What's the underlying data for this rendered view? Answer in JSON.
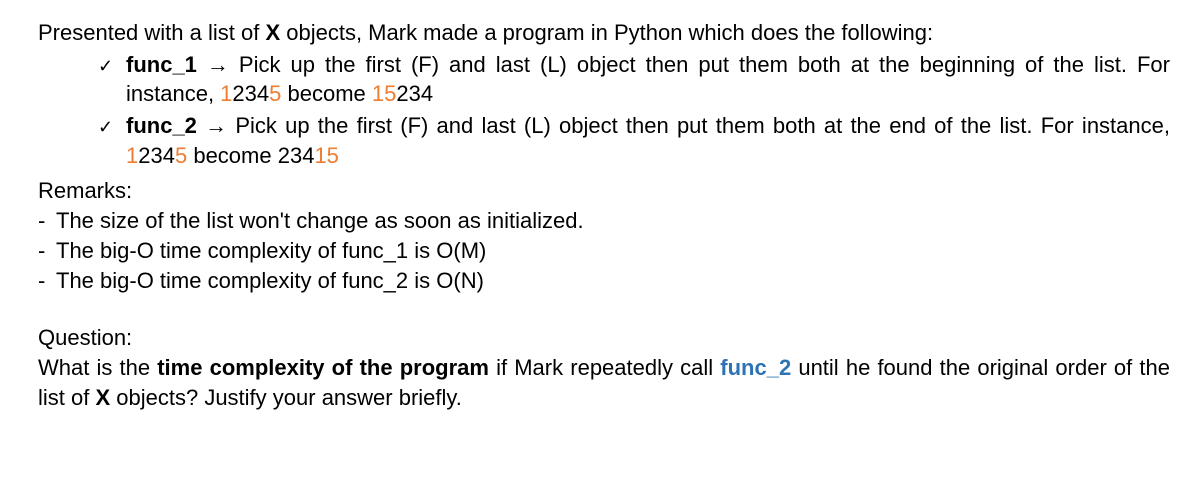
{
  "intro": {
    "part1": "Presented with a list of ",
    "boldX": "X",
    "part2": " objects, Mark made a program in Python which does the following:"
  },
  "check": "✓",
  "func1": {
    "name": "func_1",
    "arrow": " → ",
    "desc1": "Pick up the first (F) and last (L) object then put them both at the beginning of the list. For instance, ",
    "ex1_a": "1",
    "ex1_b": "234",
    "ex1_c": "5",
    "become": " become ",
    "ex2_a": "15",
    "ex2_b": "234"
  },
  "func2": {
    "name": "func_2",
    "arrow": " → ",
    "desc1": "Pick up the first (F) and last (L) object then put them both at the end of the list. For instance, ",
    "ex1_a": "1",
    "ex1_b": "234",
    "ex1_c": "5",
    "become": " become ",
    "ex2_a": "234",
    "ex2_b": "15"
  },
  "remarks": {
    "header": "Remarks:",
    "items": [
      "The size of the list won't change as soon as initialized.",
      "The big-O time complexity of func_1 is O(M)",
      "The big-O time complexity of func_2 is O(N)"
    ]
  },
  "question": {
    "header": "Question:",
    "part1": "What is the ",
    "bold1": "time complexity of the program",
    "part2": " if Mark repeatedly call ",
    "func": "func_2",
    "part3": " until he found the original order of the list of ",
    "boldX": "X",
    "part4": " objects? Justify your answer briefly."
  }
}
